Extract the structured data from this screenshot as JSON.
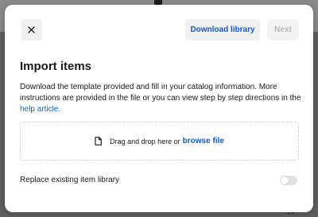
{
  "backdrop": {
    "corner_text": "14"
  },
  "modal": {
    "close_icon": "close-icon",
    "download_label": "Download library",
    "next_label": "Next",
    "title": "Import items",
    "description": "Download the template provided and fill in your catalog information. More instructions are provided in the file or you can view step by step directions in the",
    "help_link": "help article",
    "help_link_suffix": ".",
    "dropzone": {
      "icon": "file-icon",
      "text": "Drag and drop here or",
      "browse_link": "browse file"
    },
    "replace": {
      "label": "Replace existing item library",
      "toggle_on": false
    }
  },
  "colors": {
    "accent": "#0b5cd5",
    "backdrop": "#5f5f5f",
    "button_bg": "#f0f0f0",
    "disabled_text": "#b8b8b8"
  }
}
